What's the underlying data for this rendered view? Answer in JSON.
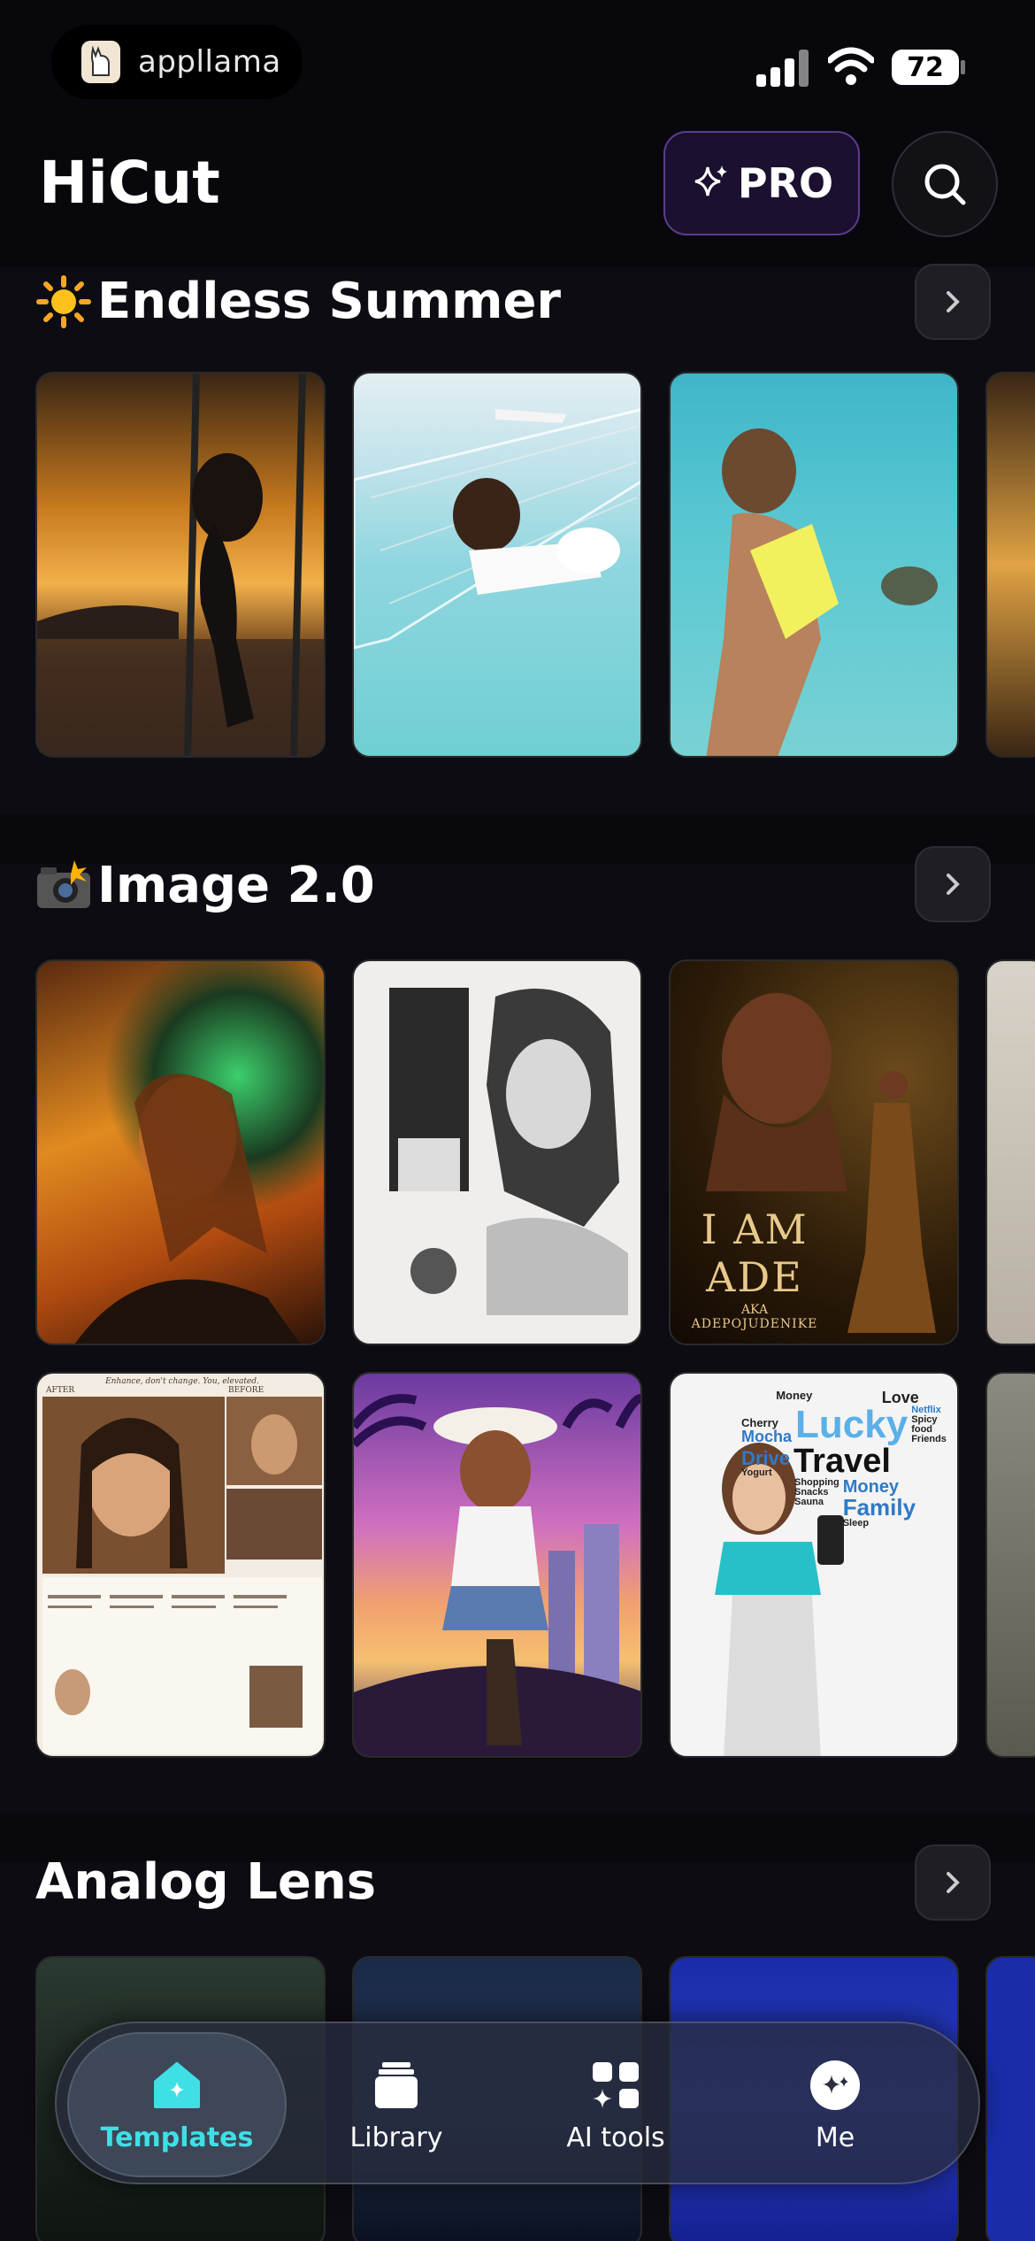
{
  "status_bar": {
    "app_pill_label": "appllama",
    "battery": "72"
  },
  "header": {
    "title": "HiCut",
    "pro_label": "PRO"
  },
  "sections": [
    {
      "title": "Endless Summer",
      "emoji": "sun-emoji"
    },
    {
      "title": "Image 2.0",
      "emoji": "camera-flash-emoji"
    },
    {
      "title": "Analog Lens",
      "emoji": ""
    }
  ],
  "image2_cards": {
    "ade_title": "I AM ADE",
    "ade_aka": "AKA",
    "ade_name": "ADEPOJUDENIKE",
    "skin_header": "Enhance, don't change. You, elevated.",
    "skin_after": "AFTER",
    "skin_before": "BEFORE",
    "travel_words": [
      "Money",
      "Love",
      "Cherry",
      "Mocha",
      "Lucky",
      "Netflix",
      "Spicy food",
      "Friends",
      "Drive",
      "Travel",
      "Yogurt",
      "Shopping",
      "Money",
      "Snacks",
      "Family",
      "Sauna",
      "Sleep"
    ]
  },
  "tabbar": {
    "tabs": [
      {
        "label": "Templates",
        "active": true
      },
      {
        "label": "Library",
        "active": false
      },
      {
        "label": "AI tools",
        "active": false
      },
      {
        "label": "Me",
        "active": false
      }
    ]
  },
  "colors": {
    "background": "#0c0c12",
    "accent": "#3ee0e6",
    "pro_border": "#5b3d8e"
  }
}
